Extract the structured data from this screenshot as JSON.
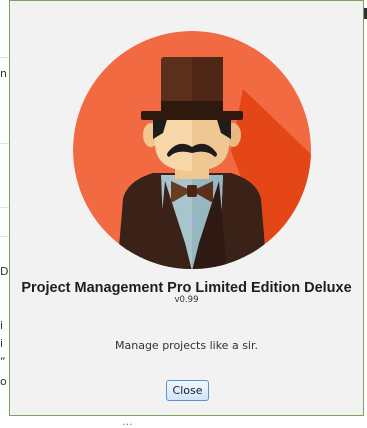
{
  "background_fragments": [
    "n",
    "D",
    "i",
    "i",
    "“",
    "o"
  ],
  "background_footer": "...",
  "dialog": {
    "avatar_icon": "gentleman-top-hat-avatar",
    "title": "Project Management Pro Limited Edition Deluxe",
    "version": "v0.99",
    "tagline": "Manage projects like a sir.",
    "close_label": "Close"
  },
  "colors": {
    "avatar_circle": "#f26a42",
    "avatar_shadow": "#e54617",
    "hat": "#5b2f1b",
    "hat_band": "#2f190f",
    "face": "#f7d7a8",
    "hair": "#1e1c1c",
    "suit": "#3a2219",
    "shirt": "#a8c4cc",
    "dialog_border": "#7aa35c",
    "dialog_bg": "#f2f2f2",
    "button_border": "#5a93c4"
  }
}
